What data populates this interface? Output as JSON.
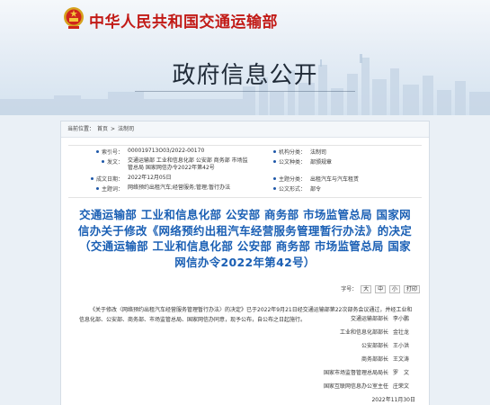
{
  "site": {
    "title": "中华人民共和国交通运输部"
  },
  "banner": {
    "title": "政府信息公开"
  },
  "breadcrumb": {
    "prefix": "当前位置：",
    "home": "首页",
    "sep": ">",
    "current": "法制司"
  },
  "info": {
    "index_label": "索引号：",
    "index_value": "000019713O03/2022-00170",
    "org_label": "机构分类：",
    "org_value": "法制司",
    "issuer_label": "发文：",
    "issuer_value": "交通运输部 工业和信息化部 公安部 商务部 市场监管总局 国家网信办令2022年第42号",
    "category_label": "公文种类：",
    "category_value": "部颁规章",
    "date_label": "成文日期：",
    "date_value": "2022年12月05日",
    "topic_label": "主题分类：",
    "topic_value": "出租汽车与汽车租赁",
    "subject_label": "主题词：",
    "subject_value": "网络预约出租汽车;经营服务;管理;暂行办法",
    "doctype_label": "公文形式：",
    "doctype_value": "部令"
  },
  "document": {
    "title": "交通运输部 工业和信息化部 公安部 商务部 市场监管总局 国家网信办关于修改《网络预约出租汽车经营服务管理暂行办法》的决定（交通运输部 工业和信息化部 公安部 商务部 市场监管总局 国家网信办令2022年第42号）",
    "font_size_label": "字号：",
    "size_large": "大",
    "size_medium": "中",
    "size_small": "小",
    "print": "打印",
    "body": "《关于修改〈网络预约出租汽车经营服务管理暂行办法〉的决定》已于2022年9月21日经交通运输部第22次部务会议通过，并经工业和信息化部、公安部、商务部、市场监管总局、国家网信办同意，现予公布，自公布之日起施行。"
  },
  "signatures": [
    {
      "org": "交通运输部部长",
      "name": "李小鹏"
    },
    {
      "org": "工业和信息化部部长",
      "name": "金壮龙"
    },
    {
      "org": "公安部部长",
      "name": "王小洪"
    },
    {
      "org": "商务部部长",
      "name": "王文涛"
    },
    {
      "org": "国家市场监督管理总局局长",
      "name": "罗　文"
    },
    {
      "org": "国家互联网信息办公室主任",
      "name": "庄荣文"
    }
  ],
  "sign_date": "2022年11月30日",
  "colors": {
    "site_title": "#c21b17",
    "doc_title": "#1a5fb4",
    "background": "#eaf0f6"
  }
}
